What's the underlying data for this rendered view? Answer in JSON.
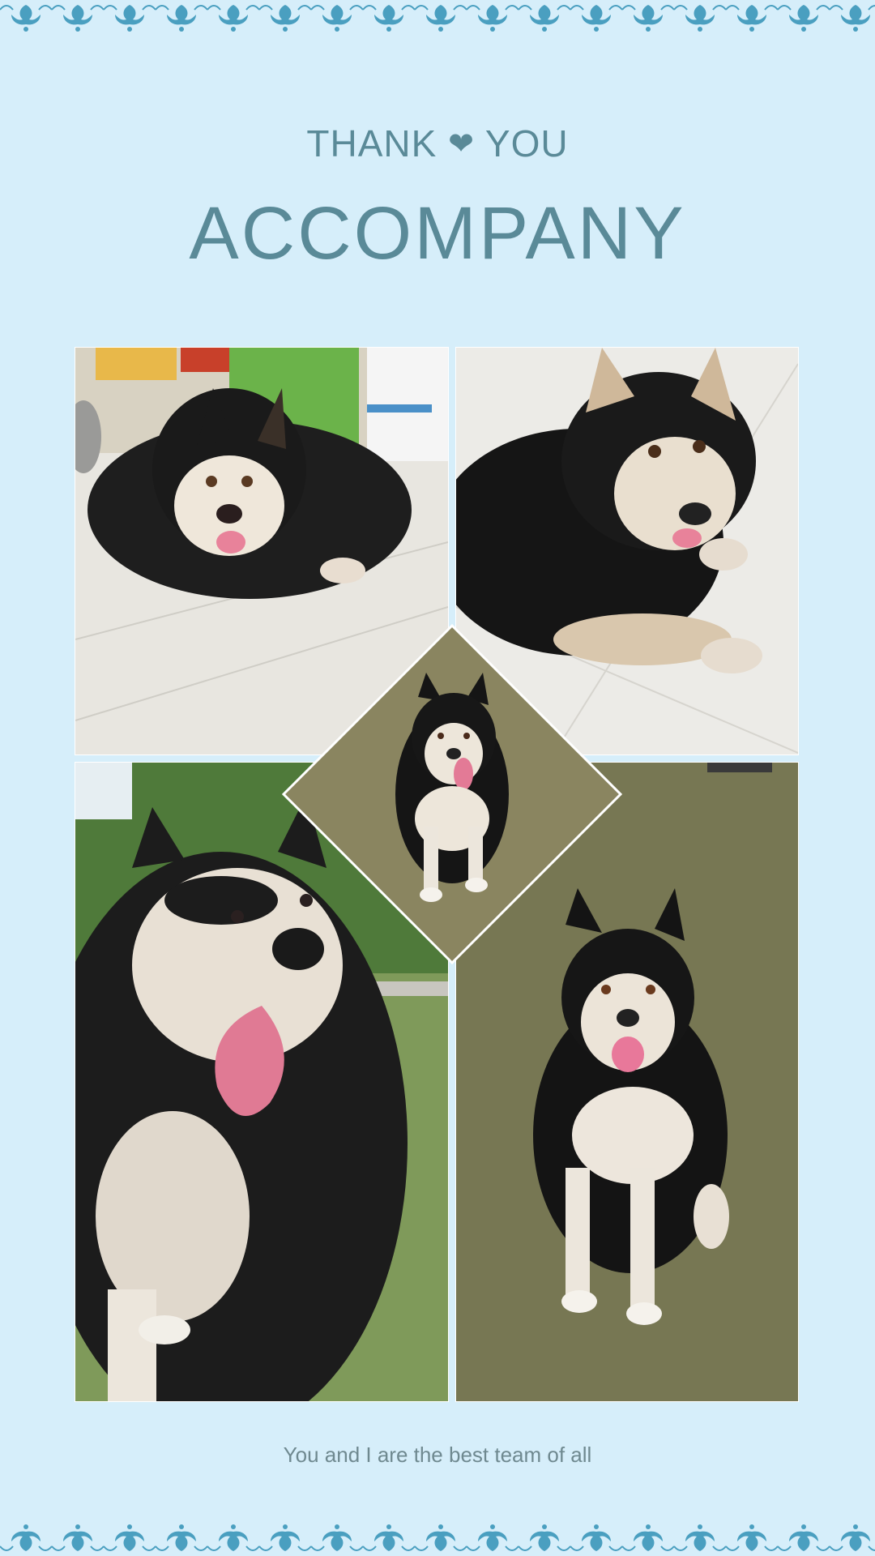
{
  "header": {
    "thank": "THANK",
    "heart_icon": "heart-icon",
    "you": "YOU",
    "title": "ACCOMPANY"
  },
  "footer": {
    "tagline": "You and I are the best team of all"
  },
  "colors": {
    "background": "#d6eefa",
    "ornament": "#4a9fc0",
    "title_text": "#5a8a98",
    "footer_text": "#6f8990"
  },
  "photos": [
    {
      "name": "photo-top-left",
      "subject": "dog-lying-indoors"
    },
    {
      "name": "photo-top-right",
      "subject": "dog-lying-on-tile"
    },
    {
      "name": "photo-center-diamond",
      "subject": "dog-sitting-on-grass"
    },
    {
      "name": "photo-bottom-left",
      "subject": "dog-closeup-tongue-out"
    },
    {
      "name": "photo-bottom-right",
      "subject": "dog-sitting-on-grass"
    }
  ]
}
